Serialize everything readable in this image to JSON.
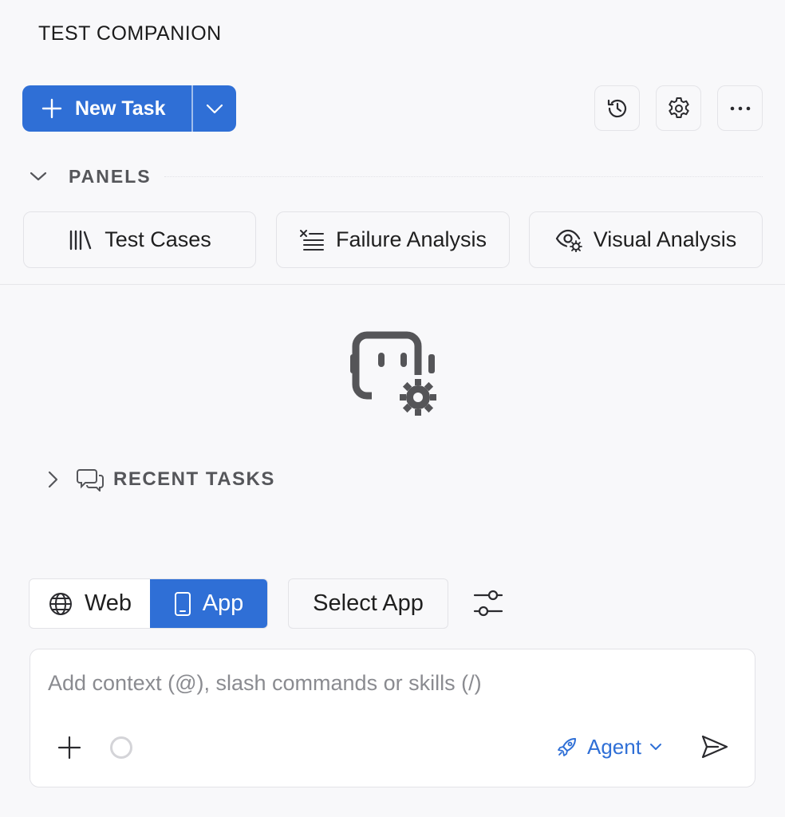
{
  "app": {
    "title": "TEST COMPANION"
  },
  "toolbar": {
    "new_task_label": "New Task",
    "icons": [
      "history-icon",
      "gear-icon",
      "more-icon"
    ]
  },
  "panels": {
    "header": "PANELS",
    "items": [
      {
        "label": "Test Cases",
        "icon": "library-icon"
      },
      {
        "label": "Failure Analysis",
        "icon": "list-x-icon"
      },
      {
        "label": "Visual Analysis",
        "icon": "eye-gear-icon"
      }
    ]
  },
  "recent": {
    "label": "RECENT TASKS",
    "expanded": false
  },
  "mode": {
    "options": [
      "Web",
      "App"
    ],
    "selected": "App",
    "select_app_label": "Select App"
  },
  "chat": {
    "placeholder": "Add context (@), slash commands or skills (/)",
    "value": "",
    "agent_label": "Agent"
  },
  "colors": {
    "accent": "#2f6fd6",
    "background": "#f8f8fa",
    "muted_text": "#55565a"
  }
}
